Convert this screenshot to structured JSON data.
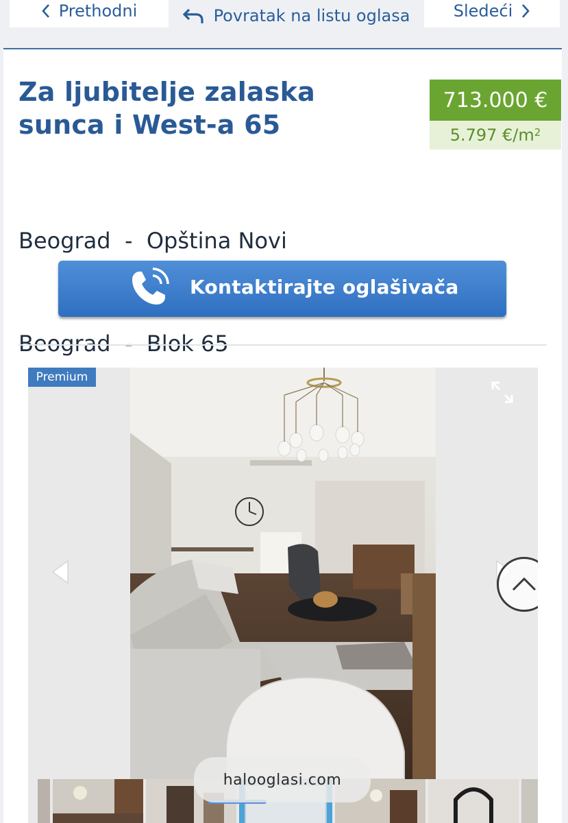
{
  "nav": {
    "prev_label": "Prethodni",
    "back_label": "Povratak na listu oglasa",
    "next_label": "Sledeći"
  },
  "listing": {
    "title_line1": "Za ljubitelje zalaska",
    "title_line2": "sunca i West-a 65",
    "price": "713.000 €",
    "price_per_sqm": "5.797 €/m",
    "price_per_sqm_unit_sup": "2",
    "location_line1": "Beograd  -  Opština Novi",
    "location_line2": "Beograd  -  Blok 65"
  },
  "contact": {
    "label": "Kontaktirajte oglašivača"
  },
  "gallery": {
    "badge": "Premium",
    "watermark": "halooglasi.com",
    "icons": [
      "expand-icon",
      "arrow-left-icon",
      "arrow-right-icon",
      "scroll-top-icon"
    ],
    "thumbnail_count": 6
  },
  "colors": {
    "brand_blue": "#2a5a95",
    "price_green": "#6aa531",
    "price_green_light": "#e7f1d8",
    "button_blue": "#3f7bc8"
  }
}
